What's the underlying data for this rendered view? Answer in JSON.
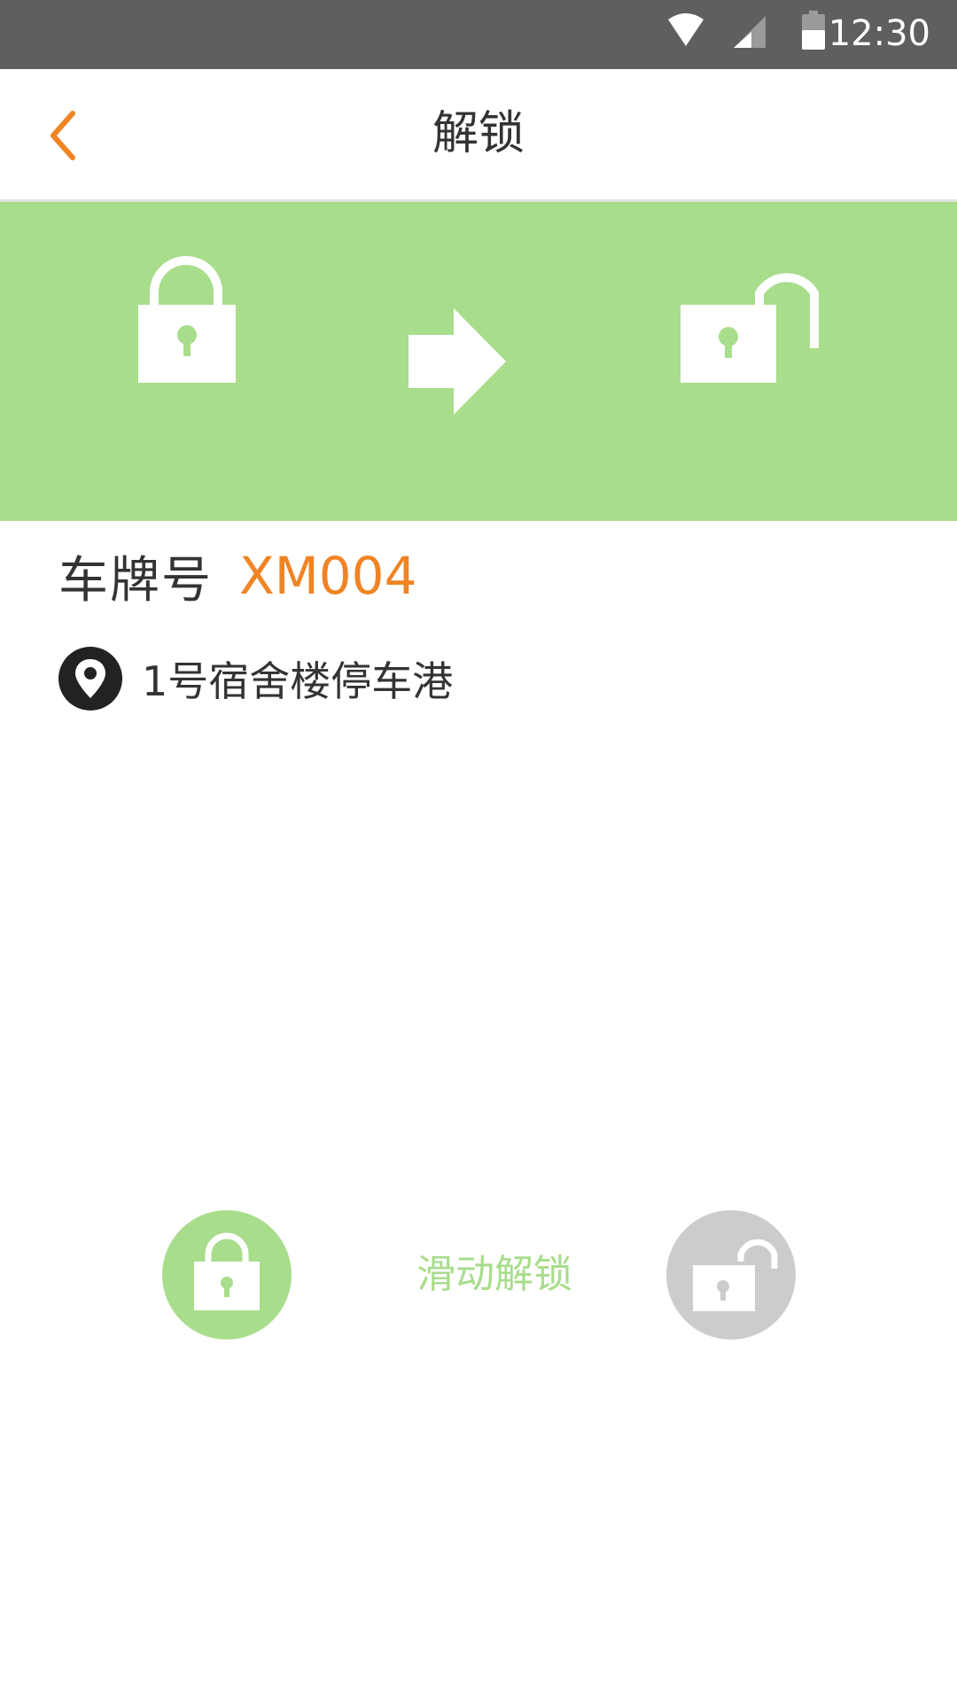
{
  "status_bar": {
    "time": "12:30",
    "icons": [
      "wifi-icon",
      "cell-signal-icon",
      "battery-icon"
    ]
  },
  "header": {
    "title": "解锁",
    "back_icon": "chevron-left-icon"
  },
  "banner": {
    "icons": [
      "locked-padlock-icon",
      "arrow-right-icon",
      "unlocked-padlock-icon"
    ]
  },
  "vehicle": {
    "plate_label": "车牌号",
    "plate_number": "XM004"
  },
  "location": {
    "icon": "location-pin-icon",
    "name": "1号宿舍楼停车港"
  },
  "unlock_slider": {
    "label": "滑动解锁",
    "start_icon": "locked-padlock-icon",
    "end_icon": "unlocked-padlock-icon"
  },
  "colors": {
    "accent_orange": "#f08424",
    "banner_green": "#a8dd8c",
    "knob_grey": "#cccccc",
    "status_bar": "#5f5f5f",
    "text_dark": "#333333"
  }
}
